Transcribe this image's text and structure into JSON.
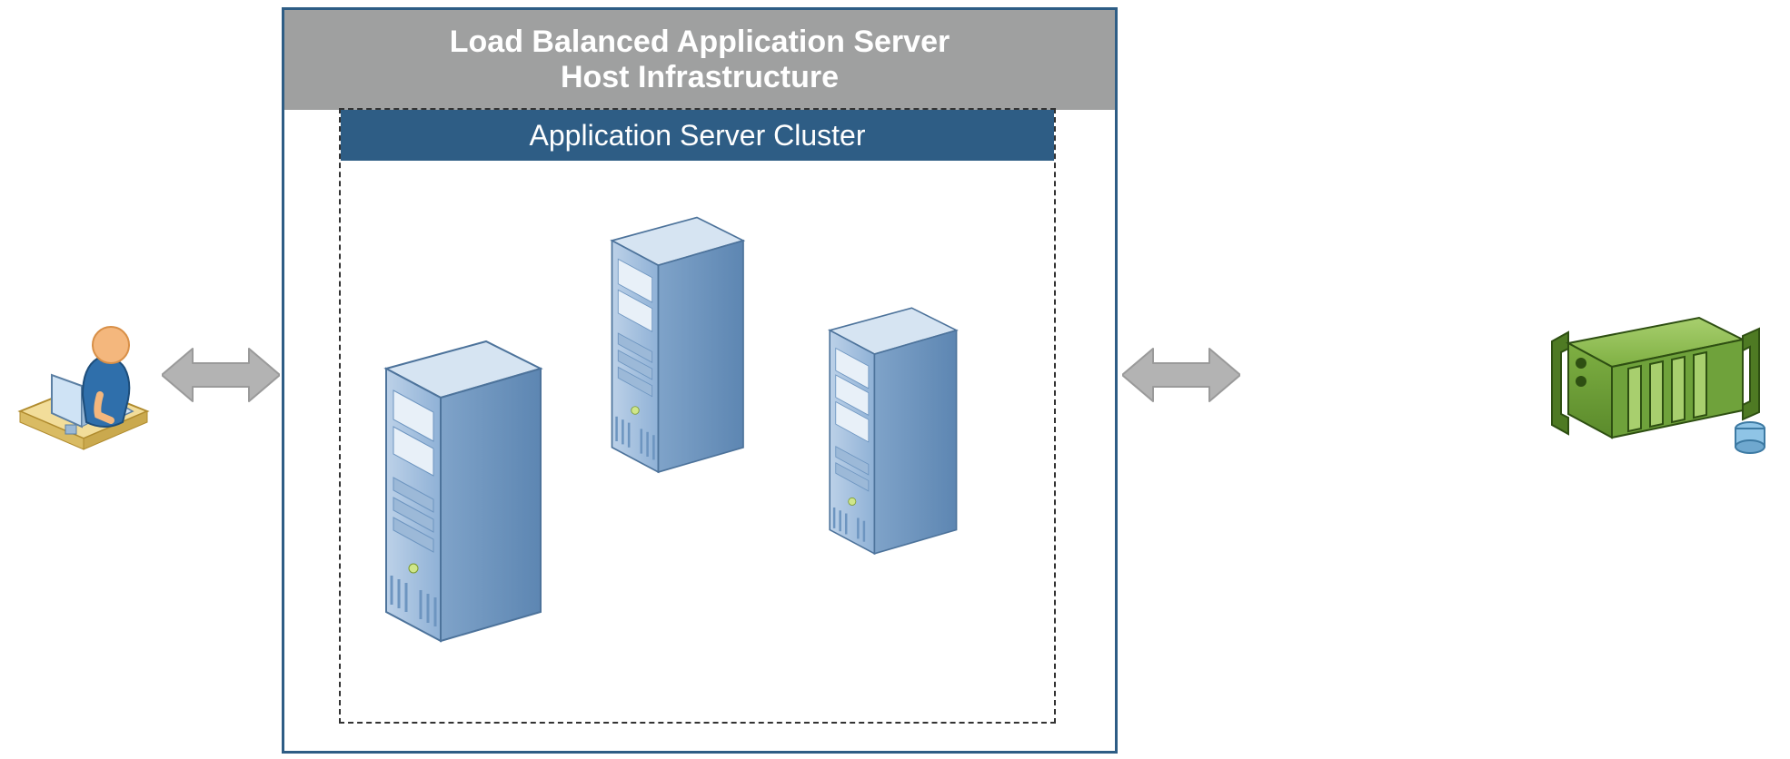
{
  "diagram": {
    "host_title": "Load Balanced Application Server\nHost Infrastructure",
    "cluster_title": "Application Server Cluster",
    "nodes": {
      "user": "user-at-workstation",
      "servers": [
        "app-server-1",
        "app-server-2",
        "app-server-3"
      ],
      "backend": "backend-device"
    },
    "connectors": [
      "user-to-cluster",
      "cluster-to-backend"
    ],
    "colors": {
      "outer_border": "#2e5d85",
      "host_title_bg": "#9fa0a0",
      "cluster_title_bg": "#2e5d85",
      "arrow_fill": "#b3b3b3",
      "server_light": "#a8c2e0",
      "server_dark": "#6d95c0",
      "device_green": "#6fa23b",
      "device_green_dark": "#4e7a23"
    }
  }
}
